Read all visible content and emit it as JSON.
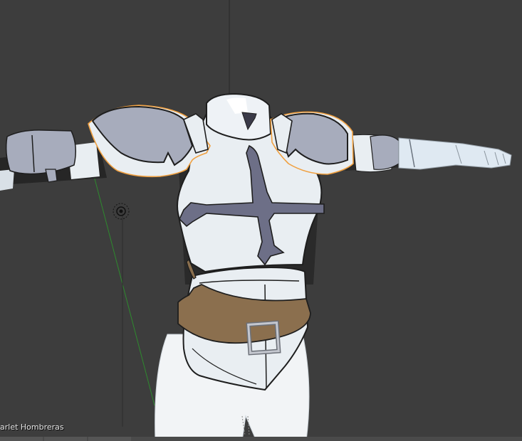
{
  "viewport": {
    "object_label": "arlet Hombreras",
    "background_color": "#3d3d3d",
    "selection_outline_color": "#f0a040",
    "grid_y_axis_color": "#2b2b2b",
    "light_line_color": "#1f8f1f"
  },
  "scene": {
    "object": "armor-torso-model",
    "materials": {
      "armor_white": "#e9eef2",
      "armor_shadow": "#c7d0da",
      "pauldron_grey": "#a7acbc",
      "cross_purple": "#6d6f87",
      "belt_brown": "#8b6f4e",
      "buckle_silver": "#b9bcc4",
      "undersuit_dark": "#2a2a2a",
      "legs_white": "#f2f4f6"
    }
  }
}
